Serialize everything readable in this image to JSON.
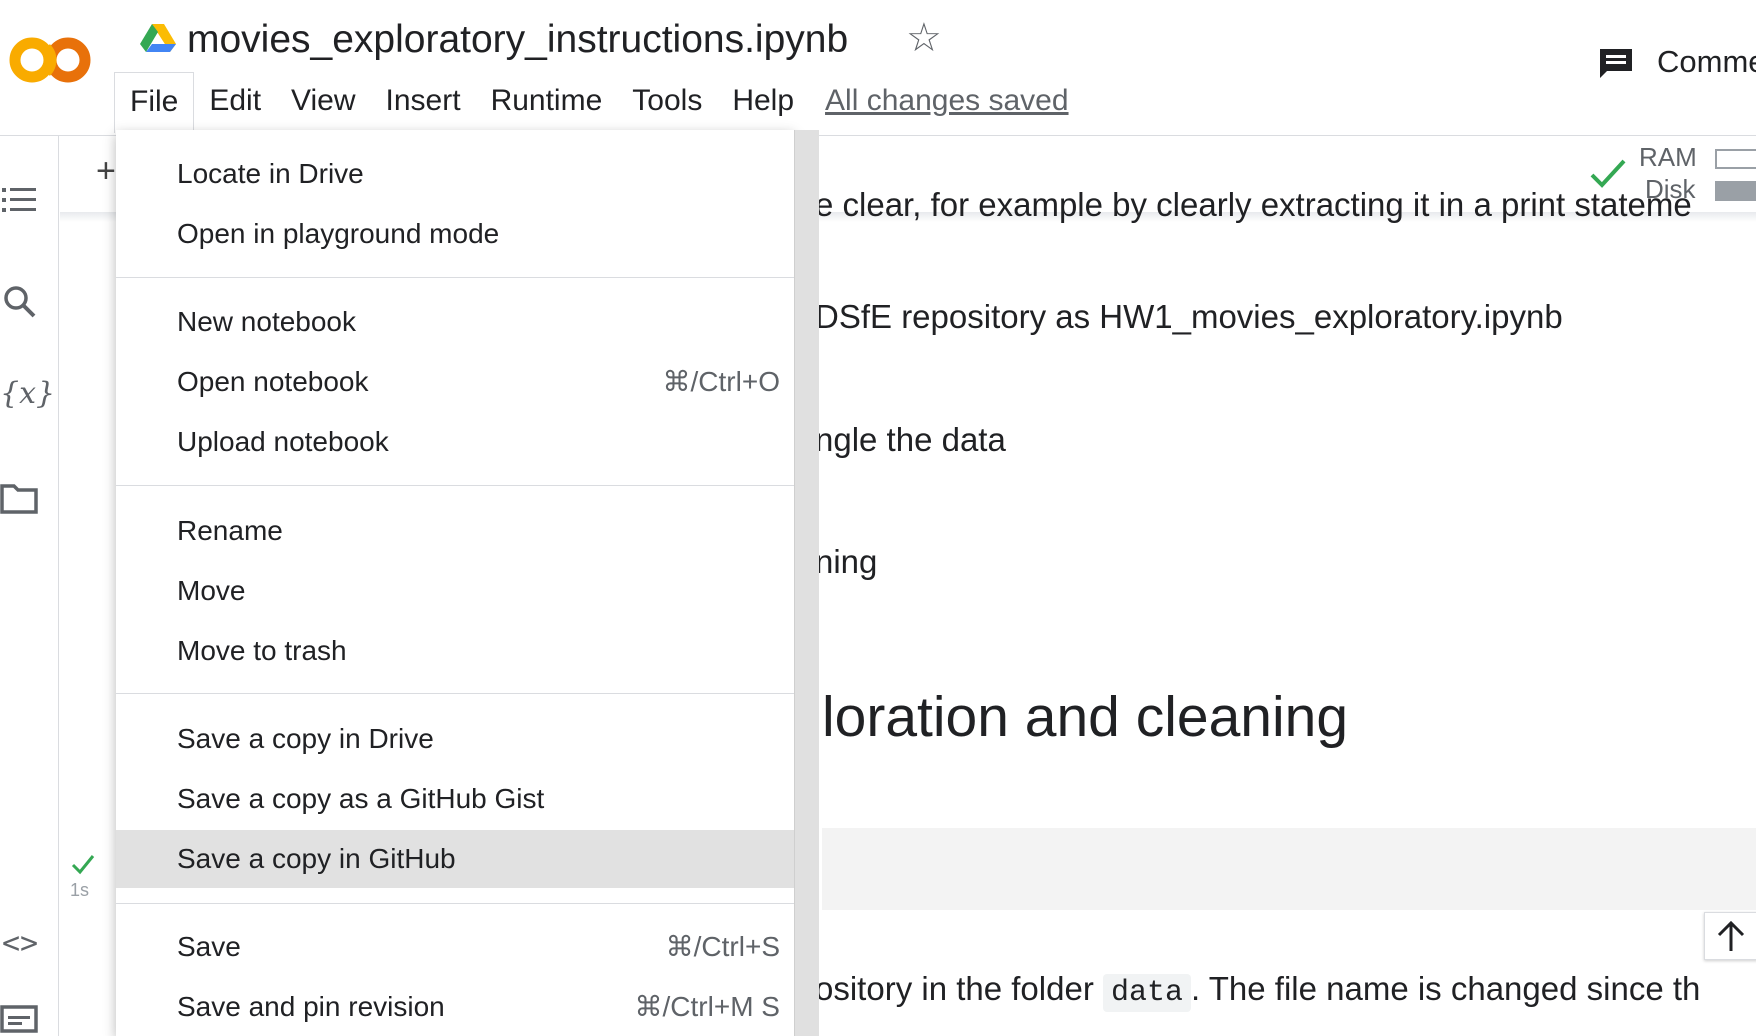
{
  "header": {
    "doc_title": "movies_exploratory_instructions.ipynb",
    "menus": [
      "File",
      "Edit",
      "View",
      "Insert",
      "Runtime",
      "Tools",
      "Help"
    ],
    "save_status": "All changes saved",
    "comment_label": "Comme",
    "colors": {
      "logo_orange": "#F9AB00",
      "logo_dark_orange": "#E8710A"
    }
  },
  "toolbar": {
    "add_label": "+",
    "ram_label": "RAM",
    "disk_label": "Disk"
  },
  "notebook": {
    "line1": "e clear, for example by clearly extracting it in a print stateme",
    "line2": "DSfE repository as HW1_movies_exploratory.ipynb",
    "line3": "ngle the data",
    "line4": "ning",
    "heading": "loration and cleaning",
    "cell_time": "1s",
    "bottom_line_before": "ository in the folder ",
    "bottom_code": "data",
    "bottom_line_after": ". The file name is changed since th"
  },
  "file_menu": {
    "items": [
      {
        "label": "Locate in Drive",
        "shortcut": ""
      },
      {
        "label": "Open in playground mode",
        "shortcut": ""
      },
      {
        "label": "New notebook",
        "shortcut": ""
      },
      {
        "label": "Open notebook",
        "shortcut": "⌘/Ctrl+O"
      },
      {
        "label": "Upload notebook",
        "shortcut": ""
      },
      {
        "label": "Rename",
        "shortcut": ""
      },
      {
        "label": "Move",
        "shortcut": ""
      },
      {
        "label": "Move to trash",
        "shortcut": ""
      },
      {
        "label": "Save a copy in Drive",
        "shortcut": ""
      },
      {
        "label": "Save a copy as a GitHub Gist",
        "shortcut": ""
      },
      {
        "label": "Save a copy in GitHub",
        "shortcut": ""
      },
      {
        "label": "Save",
        "shortcut": "⌘/Ctrl+S"
      },
      {
        "label": "Save and pin revision",
        "shortcut": "⌘/Ctrl+M S"
      }
    ],
    "highlight_color": "#e1e1e1"
  },
  "icons": {
    "left_rail": [
      "toc-icon",
      "search-icon",
      "variables-icon",
      "folder-icon",
      "code-snippets-icon",
      "terminal-icon"
    ],
    "variables_glyph": "{x}",
    "code_glyph": "<>"
  }
}
